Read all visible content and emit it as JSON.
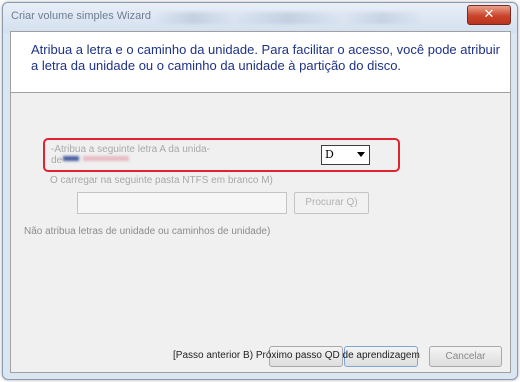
{
  "window": {
    "title": "Criar volume simples Wizard",
    "close_glyph": "✕"
  },
  "header": {
    "description": "Atribua a letra e o caminho da unidade. Para facilitar o acesso, você pode atribuir a letra da unidade ou o caminho da unidade à partição do disco."
  },
  "options": {
    "assign_letter_label": "-Atribua a seguinte letra A da unida-",
    "assign_letter_label_cont": "de",
    "selected_letter": "D",
    "mount_folder_label": "O carregar na seguinte pasta NTFS em branco M)",
    "browse_label": "Procurar Q)",
    "no_letter_label": "Não atribua letras de unidade ou caminhos de unidade)"
  },
  "footer": {
    "nav_text": "[Passo anterior B) Próximo passo QD de aprendizagem",
    "cancel_label": "Cancelar"
  },
  "colors": {
    "header_text": "#1e3287",
    "highlight_border": "#e0242f",
    "close_button": "#c9442b"
  }
}
